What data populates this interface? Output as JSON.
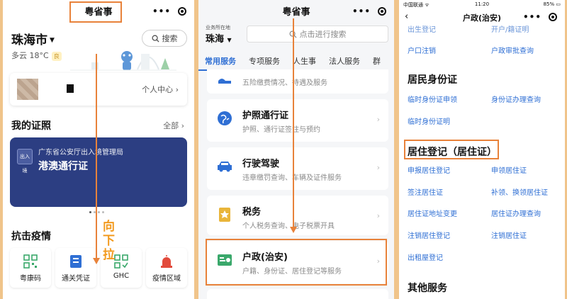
{
  "panel1": {
    "title": "粤省事",
    "city": "珠海市",
    "weather": "多云 18°C",
    "aqi_badge": "良",
    "search_label": "搜索",
    "personal_center": "个人中心",
    "my_certs_title": "我的证照",
    "all_label": "全部",
    "cert_issuer": "广东省公安厅出入境管理局",
    "cert_name": "港澳通行证",
    "cert_emblem": "出入境",
    "epidemic_title": "抗击疫情",
    "pull_hint": [
      "向",
      "下",
      "拉"
    ],
    "quick_actions": [
      {
        "label": "粤康码",
        "icon": "qr-grid-icon"
      },
      {
        "label": "通关凭证",
        "icon": "pass-doc-icon"
      },
      {
        "label": "GHC",
        "icon": "ghc-qr-icon"
      },
      {
        "label": "疫情区域",
        "icon": "alarm-icon"
      }
    ]
  },
  "panel2": {
    "title": "粤省事",
    "region_label": "业务所在地",
    "region_value": "珠海",
    "search_placeholder": "点击进行搜索",
    "tabs": [
      "常用服务",
      "专项服务",
      "人生事",
      "法人服务",
      "群"
    ],
    "services": [
      {
        "title": "",
        "desc": "五险缴费情况、待遇及服务",
        "icon": "social-security-icon"
      },
      {
        "title": "护照通行证",
        "desc": "护照、通行证签注与预约",
        "icon": "globe-icon"
      },
      {
        "title": "行驶驾驶",
        "desc": "违章缴罚查询、车辆及证件服务",
        "icon": "car-icon"
      },
      {
        "title": "税务",
        "desc": "个人税务查询、电子税票开具",
        "icon": "tax-icon"
      },
      {
        "title": "户政(治安)",
        "desc": "户籍、身份证、居住登记等服务",
        "icon": "household-icon"
      }
    ]
  },
  "panel3": {
    "carrier": "中国联通 ᯤ",
    "time": "11:20",
    "battery": "85%",
    "title": "户政(治安)",
    "top_cut": [
      "出生登记",
      "开户/籍证明"
    ],
    "row_a": [
      "户口注销",
      "户政审批查询"
    ],
    "resident_id_title": "居民身份证",
    "resident_id_links": [
      "临时身份证申领",
      "身份证办理查询",
      "临时身份证明"
    ],
    "residence_title": "居住登记（居住证）",
    "residence_links": [
      "申报居住登记",
      "申领居住证",
      "签注居住证",
      "补领、换领居住证",
      "居住证地址变更",
      "居住证办理查询",
      "注销居住登记",
      "注销居住证",
      "出租屋登记"
    ],
    "other_title": "其他服务"
  },
  "colors": {
    "accent": "#e8823a",
    "link": "#2f6fd4",
    "cert_card": "#2c3e82"
  }
}
